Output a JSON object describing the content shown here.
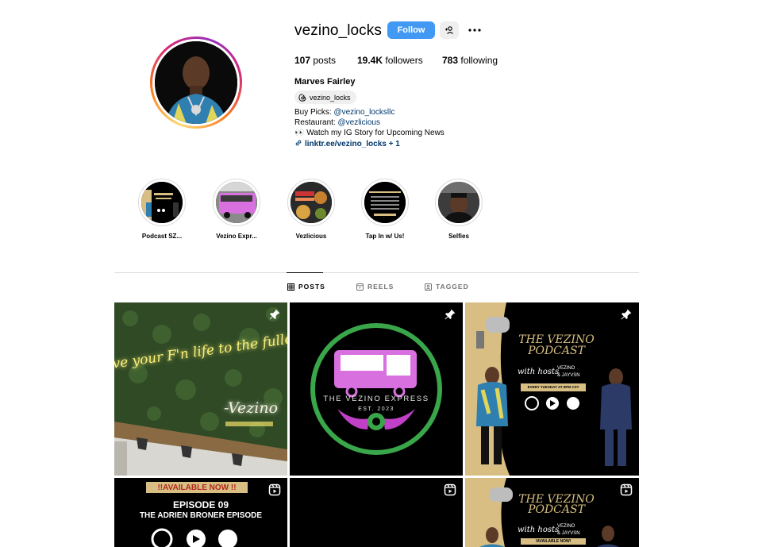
{
  "profile": {
    "username": "vezino_locks",
    "verified": true,
    "follow_label": "Follow",
    "stats": {
      "posts_count": "107",
      "posts_label": "posts",
      "followers_count": "19.4K",
      "followers_label": "followers",
      "following_count": "783",
      "following_label": "following"
    },
    "full_name": "Marves Fairley",
    "threads_handle": "vezino_locks",
    "bio": {
      "line1_prefix": "Buy Picks: ",
      "line1_mention": "@vezino_locksllc",
      "line2_prefix": "Restaurant: ",
      "line2_mention": "@vezlicious",
      "line3": "👀 Watch my IG Story for Upcoming News",
      "link": "linktr.ee/vezino_locks + 1"
    }
  },
  "highlights": [
    {
      "label": "Podcast SZ..."
    },
    {
      "label": "Vezino Expr..."
    },
    {
      "label": "Vezlicious"
    },
    {
      "label": "Tap In w/ Us!"
    },
    {
      "label": "Selfies"
    }
  ],
  "tabs": [
    {
      "label": "POSTS",
      "active": true
    },
    {
      "label": "REELS",
      "active": false
    },
    {
      "label": "TAGGED",
      "active": false
    }
  ],
  "posts": {
    "p1": {
      "neon_text": "Live your F'n life to the fullest",
      "signature": "-Vezino",
      "badge": "pin-icon"
    },
    "p2": {
      "title": "THE VEZINO EXPRESS",
      "est": "EST. 2023",
      "badge": "pin-icon"
    },
    "p3": {
      "title_1": "THE VEZINO",
      "title_2": "PODCAST",
      "with_hosts": "with hosts",
      "host_1": "VEZINO",
      "host_2": "& JAYVSN",
      "schedule": "EVERY TUESDAY AT 8PM CST",
      "badge": "pin-icon"
    },
    "p4": {
      "banner": "!!AVAILABLE NOW !!",
      "episode": "EPISODE 09",
      "episode_title": "THE ADRIEN BRONER EPISODE",
      "badge": "reel-icon"
    },
    "p5": {
      "badge": "reel-icon"
    },
    "p6": {
      "title_1": "THE VEZINO",
      "title_2": "PODCAST",
      "with_hosts": "with hosts",
      "host_1": "VEZINO",
      "host_2": "& JAYVSN",
      "schedule": "!AVAILABLE NOW!",
      "badge": "reel-icon"
    }
  },
  "colors": {
    "follow_blue": "#4199f3",
    "link_navy": "#00376b",
    "podcast_gold": "#d8be83",
    "bus_green": "#3aa64a",
    "bus_purple": "#d870e0"
  }
}
